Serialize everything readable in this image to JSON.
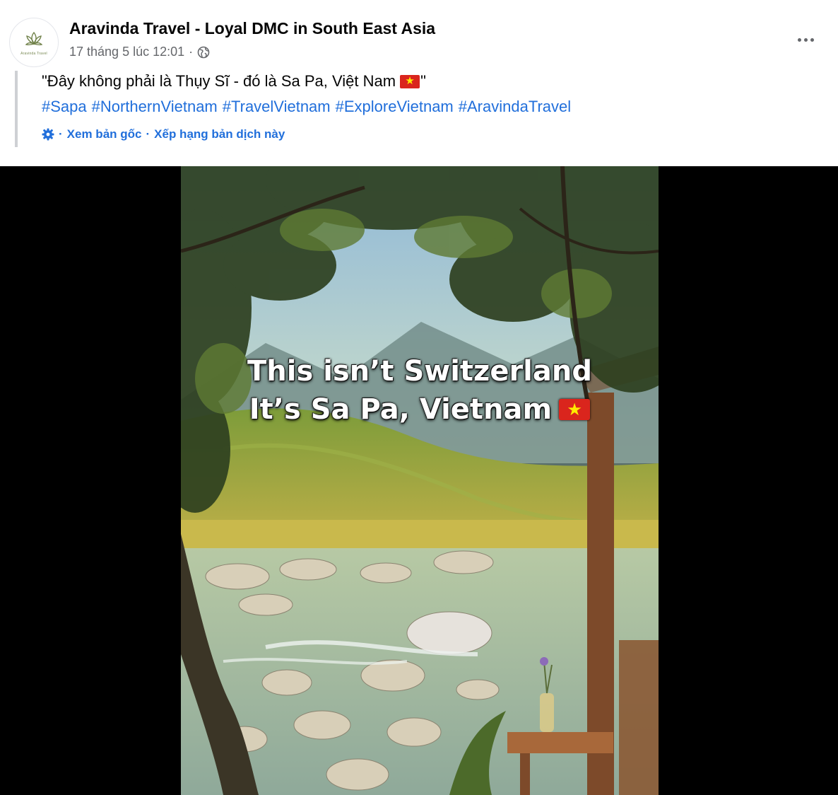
{
  "post": {
    "page_name": "Aravinda Travel - Loyal DMC in South East Asia",
    "logo_text": "Aravinda Travel",
    "timestamp": "17 tháng 5 lúc 12:01",
    "separator": "·",
    "privacy_icon": "globe-icon",
    "more_icon": "more-options-icon"
  },
  "caption": {
    "text_before": "\"Đây không phải là Thụy Sĩ - đó là Sa Pa, Việt Nam",
    "flag": "vietnam-flag",
    "text_after": "\"",
    "hashtags": [
      "#Sapa",
      "#NorthernVietnam",
      "#TravelVietnam",
      "#ExploreVietnam",
      "#AravindaTravel"
    ]
  },
  "translation": {
    "icon": "translate-gear-icon",
    "separator": "·",
    "see_original": "Xem bản gốc",
    "rate_translation": "Xếp hạng bản dịch này"
  },
  "video": {
    "overlay_line_1": "This isn’t Switzerland",
    "overlay_line_2": "It’s Sa Pa, Vietnam"
  },
  "colors": {
    "link": "#216fdb",
    "secondary_text": "#65676b",
    "primary_text": "#050505",
    "quote_bar": "#ced0d4",
    "flag_red": "#da251d",
    "flag_star": "#ffeb00"
  }
}
